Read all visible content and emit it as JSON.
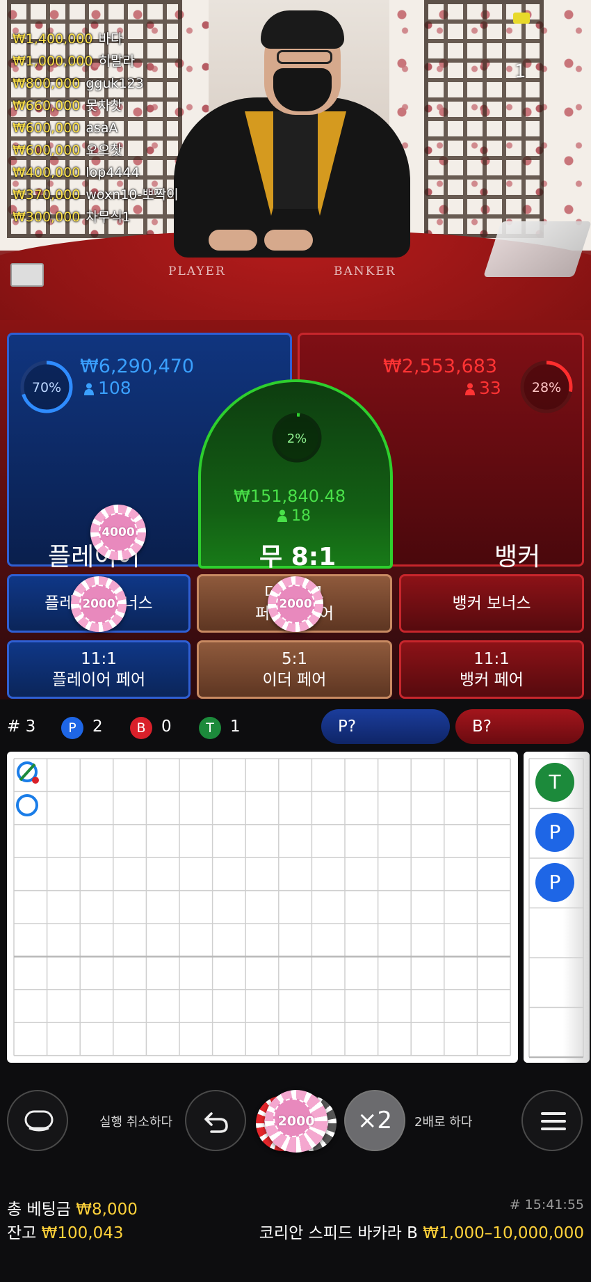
{
  "leaderboard": [
    {
      "amount": "₩1,400,000",
      "name": "바다"
    },
    {
      "amount": "₩1,000,000",
      "name": "히말라"
    },
    {
      "amount": "₩800,000",
      "name": "gguk123"
    },
    {
      "amount": "₩660,000",
      "name": "못차찻"
    },
    {
      "amount": "₩600,000",
      "name": "asaA"
    },
    {
      "amount": "₩600,000",
      "name": "오으찻"
    },
    {
      "amount": "₩400,000",
      "name": "lop4444"
    },
    {
      "amount": "₩370,000",
      "name": "woxn10-뽀짝이"
    },
    {
      "amount": "₩300,000",
      "name": "차무식1"
    }
  ],
  "video": {
    "round_number": "1",
    "felt_player": "PLAYER",
    "felt_banker": "BANKER"
  },
  "colors": {
    "player_blue": "#2f5fd4",
    "banker_red": "#c7262c",
    "tie_green": "#2ecf2e",
    "gold": "#ffd23a"
  },
  "bets": {
    "player": {
      "label": "플레이어",
      "amount": "₩6,290,470",
      "players": "108",
      "percent": "70%",
      "percent_value": 0.7,
      "chip": "4000"
    },
    "banker": {
      "label": "뱅커",
      "amount": "₩2,553,683",
      "players": "33",
      "percent": "28%",
      "percent_value": 0.28
    },
    "tie": {
      "label": "무 8:1",
      "amount": "₩151,840.48",
      "players": "18",
      "percent": "2%",
      "percent_value": 0.02
    },
    "player_bonus": {
      "label": "플레이어 보너스",
      "chip": "2000"
    },
    "either_perfect": {
      "line1": "더블 5:1",
      "line2": "퍼펙트 페어",
      "chip": "2000"
    },
    "banker_bonus": {
      "label": "뱅커 보너스"
    },
    "player_pair": {
      "odds": "11:1",
      "label": "플레이어 페어"
    },
    "either_pair": {
      "odds": "5:1",
      "label": "이더 페어"
    },
    "banker_pair": {
      "odds": "11:1",
      "label": "뱅커 페어"
    }
  },
  "stats": {
    "rounds": "# 3",
    "player_badge": "P",
    "player_count": "2",
    "banker_badge": "B",
    "banker_count": "0",
    "tie_badge": "T",
    "tie_count": "1",
    "predict_player": "P?",
    "predict_banker": "B?"
  },
  "bead_road": [
    {
      "letter": "T",
      "type": "tie"
    },
    {
      "letter": "P",
      "type": "player"
    },
    {
      "letter": "P",
      "type": "player"
    }
  ],
  "controls": {
    "undo_label": "실행 취소하다",
    "chip_value": "2000",
    "double_button": "×2",
    "double_label": "2배로 하다"
  },
  "footer": {
    "total_bet_label": "총 베팅금",
    "total_bet_value": "₩8,000",
    "balance_label": "잔고",
    "balance_value": "₩100,043",
    "time": "# 15:41:55",
    "table_name": "코리안 스피드 바카라 B",
    "limits": "₩1,000–10,000,000"
  }
}
